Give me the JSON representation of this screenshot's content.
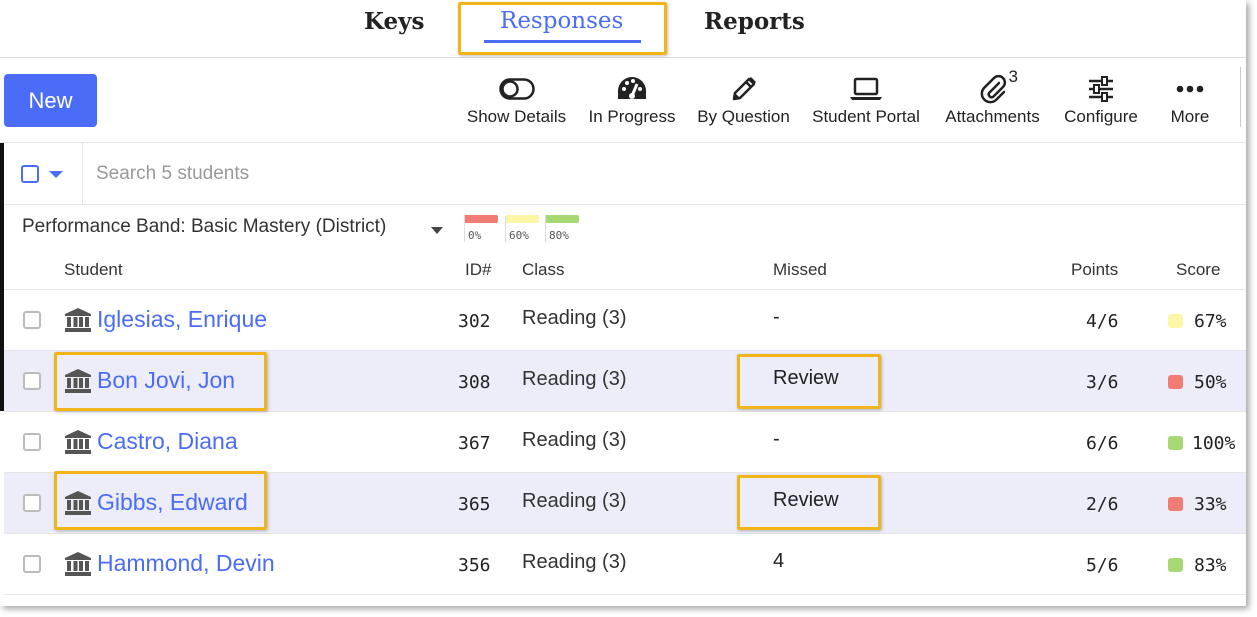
{
  "tabs": {
    "keys": "Keys",
    "responses": "Responses",
    "reports": "Reports",
    "active": "Responses"
  },
  "toolbar": {
    "new_label": "New",
    "tools": [
      {
        "id": "show-details",
        "label": "Show Details",
        "icon": "toggle-icon"
      },
      {
        "id": "in-progress",
        "label": "In Progress",
        "icon": "gauge-icon"
      },
      {
        "id": "by-question",
        "label": "By Question",
        "icon": "pencil-icon"
      },
      {
        "id": "student-portal",
        "label": "Student Portal",
        "icon": "laptop-icon"
      },
      {
        "id": "attachments",
        "label": "Attachments",
        "icon": "paperclip-icon",
        "count": "3"
      },
      {
        "id": "configure",
        "label": "Configure",
        "icon": "sliders-icon"
      },
      {
        "id": "more",
        "label": "More",
        "icon": "more-dots-icon"
      }
    ]
  },
  "search": {
    "placeholder": "Search 5 students"
  },
  "performance_band": {
    "label": "Performance Band: Basic Mastery (District)",
    "bands": [
      {
        "pct": "0%",
        "color": "#f07c74"
      },
      {
        "pct": "60%",
        "color": "#fbf7a6"
      },
      {
        "pct": "80%",
        "color": "#a8d873"
      }
    ]
  },
  "columns": {
    "student": "Student",
    "id": "ID#",
    "class": "Class",
    "missed": "Missed",
    "points": "Points",
    "score": "Score"
  },
  "rows": [
    {
      "name": "Iglesias, Enrique",
      "id": "302",
      "class": "Reading (3)",
      "missed": "-",
      "points": "4/6",
      "score": "67%",
      "score_color": "#fbf7a6",
      "highlighted": false
    },
    {
      "name": "Bon Jovi, Jon",
      "id": "308",
      "class": "Reading (3)",
      "missed": "Review",
      "points": "3/6",
      "score": "50%",
      "score_color": "#f07c74",
      "highlighted": true
    },
    {
      "name": "Castro, Diana",
      "id": "367",
      "class": "Reading (3)",
      "missed": "-",
      "points": "6/6",
      "score": "100%",
      "score_color": "#a8d873",
      "highlighted": false
    },
    {
      "name": "Gibbs, Edward",
      "id": "365",
      "class": "Reading (3)",
      "missed": "Review",
      "points": "2/6",
      "score": "33%",
      "score_color": "#f07c74",
      "highlighted": true
    },
    {
      "name": "Hammond, Devin",
      "id": "356",
      "class": "Reading (3)",
      "missed": "4",
      "points": "5/6",
      "score": "83%",
      "score_color": "#a8d873",
      "highlighted": false
    }
  ],
  "colors": {
    "accent": "#4a6cf7",
    "highlight_box": "#f2b519",
    "alt_row": "#ecedf9"
  }
}
